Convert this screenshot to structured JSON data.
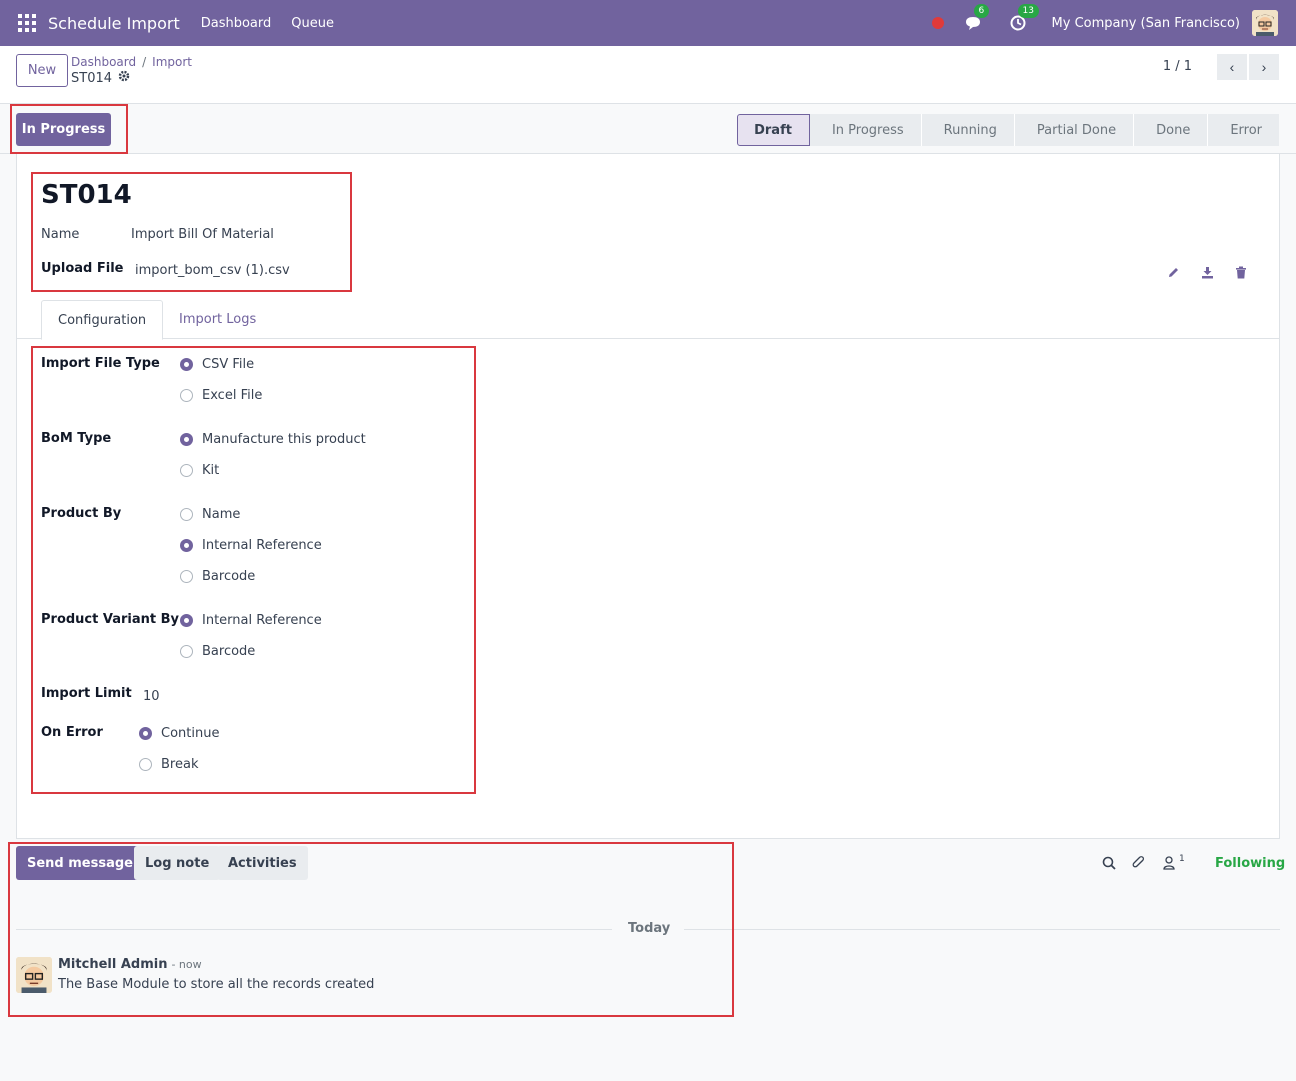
{
  "navbar": {
    "brand": "Schedule Import",
    "links": [
      "Dashboard",
      "Queue"
    ],
    "messages_count": "6",
    "activities_count": "13",
    "company": "My Company (San Francisco)"
  },
  "control_panel": {
    "new_label": "New",
    "breadcrumb": [
      "Dashboard",
      "Import"
    ],
    "record_name": "ST014",
    "pager": "1 / 1"
  },
  "statusbar": {
    "action_label": "In Progress",
    "stages": [
      "Draft",
      "In Progress",
      "Running",
      "Partial Done",
      "Done",
      "Error"
    ],
    "active_stage": "Draft"
  },
  "form": {
    "title": "ST014",
    "name_label": "Name",
    "name_value": "Import Bill Of Material",
    "upload_label": "Upload File",
    "upload_value": "import_bom_csv (1).csv",
    "tabs": [
      "Configuration",
      "Import Logs"
    ],
    "import_file_type": {
      "label": "Import File Type",
      "options": [
        "CSV File",
        "Excel File"
      ],
      "selected": "CSV File"
    },
    "bom_type": {
      "label": "BoM Type",
      "options": [
        "Manufacture this product",
        "Kit"
      ],
      "selected": "Manufacture this product"
    },
    "product_by": {
      "label": "Product By",
      "options": [
        "Name",
        "Internal Reference",
        "Barcode"
      ],
      "selected": "Internal Reference"
    },
    "product_variant_by": {
      "label": "Product Variant By",
      "options": [
        "Internal Reference",
        "Barcode"
      ],
      "selected": "Internal Reference"
    },
    "import_limit": {
      "label": "Import Limit",
      "value": "10"
    },
    "on_error": {
      "label": "On Error",
      "options": [
        "Continue",
        "Break"
      ],
      "selected": "Continue"
    }
  },
  "chatter": {
    "send_message": "Send message",
    "log_note": "Log note",
    "activities": "Activities",
    "followers_count": "1",
    "following": "Following",
    "day": "Today",
    "message": {
      "author": "Mitchell Admin",
      "time": "- now",
      "body": "The Base Module to store all the records created"
    }
  },
  "colors": {
    "brand": "#71639e",
    "annotation": "#d9383f",
    "following": "#28a745"
  }
}
